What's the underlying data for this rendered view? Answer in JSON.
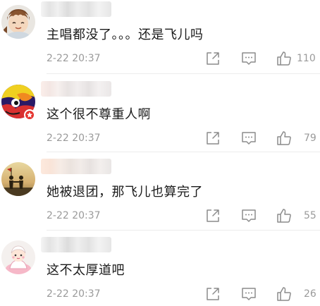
{
  "comments": [
    {
      "avatar_icon": "cartoon-boy-avatar-icon",
      "content": "主唱都没了。。。还是飞儿吗",
      "time": "2-22 20:37",
      "likes": "110"
    },
    {
      "avatar_icon": "colorful-avatar-icon",
      "verified_badge_icon": "verified-star-icon",
      "content": "这个很不尊重人啊",
      "time": "2-22 20:37",
      "likes": "79"
    },
    {
      "avatar_icon": "sunset-silhouette-avatar-icon",
      "content": "她被退团，那飞儿也算完了",
      "time": "2-22 20:37",
      "likes": "55"
    },
    {
      "avatar_icon": "cartoon-girl-avatar-icon",
      "content": "这不太厚道吧",
      "time": "2-22 20:37",
      "likes": "26"
    }
  ],
  "actions": {
    "share_icon": "share-icon",
    "reply_icon": "comment-icon",
    "like_icon": "thumbs-up-icon"
  },
  "colors": {
    "text": "#1a1a1a",
    "meta": "#9a9a9a",
    "badge": "#e5322d",
    "divider": "#ececec"
  }
}
